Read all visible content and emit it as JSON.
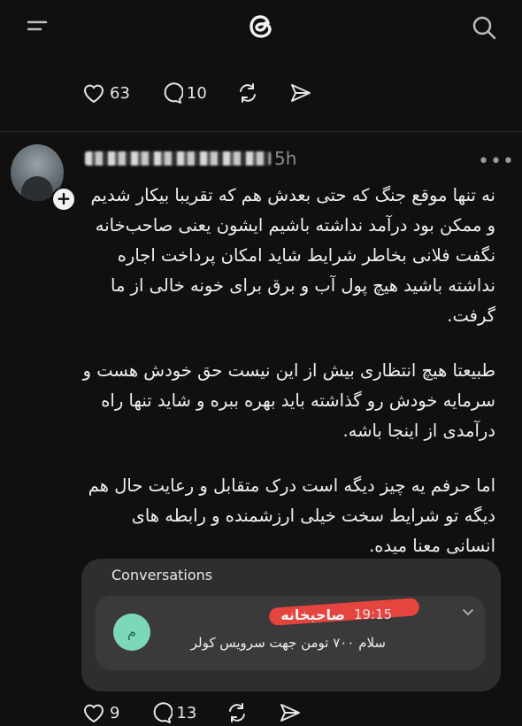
{
  "topbar": {
    "menu_icon": "menu-icon",
    "logo_icon": "threads-logo-icon",
    "search_icon": "search-icon"
  },
  "prev_post_actions": {
    "likes": "63",
    "replies": "10"
  },
  "post": {
    "time": "5h",
    "paragraphs": [
      "نه تنها موقع جنگ که حتی بعدش هم که تقریبا بیکار شدیم و ممکن بود درآمد نداشته باشیم ایشون یعنی صاحب‌خانه نگفت فلانی بخاطر شرایط شاید امکان پرداخت اجاره نداشته باشید هیچ پول آب و برق برای خونه خالی از ما گرفت.",
      "طبیعتا هیچ انتظاری بیش از این نیست حق خودش هست و سرمایه خودش رو گذاشته باید بهره ببره و شاید تنها راه درآمدی از اینجا باشه.",
      "اما حرفم یه چیز دیگه است درک متقابل و رعایت حال هم دیگه تو شرایط سخت خیلی ارزشمنده و رابطه های انسانی معنا میده."
    ],
    "card": {
      "title": "Conversations",
      "avatar_letter": "م",
      "sender": "صاحبخانه",
      "time": "19:15",
      "message": "سلام ۷۰۰ تومن جهت سرویس کولر"
    },
    "likes": "9",
    "replies": "13"
  }
}
